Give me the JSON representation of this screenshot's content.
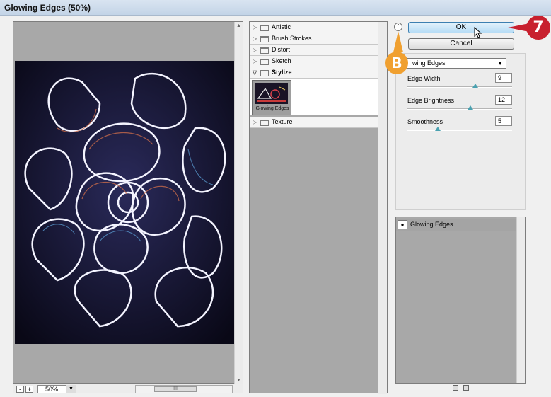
{
  "window": {
    "title": "Glowing Edges (50%)"
  },
  "preview": {
    "zoom_minus": "-",
    "zoom_plus": "+",
    "zoom_value": "50%",
    "scroll_thumb": "III"
  },
  "gallery": {
    "categories": [
      {
        "label": "Artistic",
        "expanded": false
      },
      {
        "label": "Brush Strokes",
        "expanded": false
      },
      {
        "label": "Distort",
        "expanded": false
      },
      {
        "label": "Sketch",
        "expanded": false
      },
      {
        "label": "Stylize",
        "expanded": true
      },
      {
        "label": "Texture",
        "expanded": false
      }
    ],
    "stylize_filters": [
      {
        "label": "Glowing Edges"
      }
    ]
  },
  "buttons": {
    "ok": "OK",
    "cancel": "Cancel"
  },
  "settings": {
    "filter_selected": "Glowing Edges",
    "filter_selected_visible": "wing Edges",
    "params": [
      {
        "label": "Edge Width",
        "value": "9",
        "slider": 0.63
      },
      {
        "label": "Edge Brightness",
        "value": "12",
        "slider": 0.6
      },
      {
        "label": "Smoothness",
        "value": "5",
        "slider": 0.3
      }
    ]
  },
  "layers": {
    "items": [
      {
        "label": "Glowing Edges"
      }
    ]
  },
  "callouts": {
    "b": "B",
    "seven": "7"
  },
  "colors": {
    "ok_accent": "#b6dcf5",
    "callout_b": "#f0a030",
    "callout_7": "#c8202e",
    "slider_knob": "#4aa1b0"
  }
}
